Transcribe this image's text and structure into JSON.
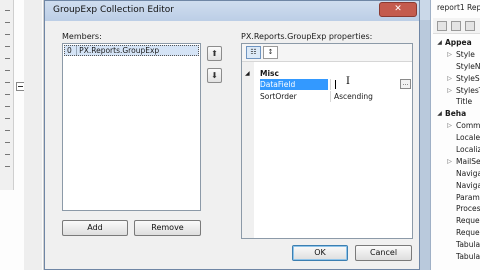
{
  "dialog": {
    "title": "GroupExp Collection Editor",
    "close_glyph": "✕",
    "members_label": "Members:",
    "members": [
      {
        "index": "0",
        "name": "PX.Reports.GroupExp"
      }
    ],
    "up_glyph": "⬆",
    "down_glyph": "⬇",
    "add_label": "Add",
    "remove_label": "Remove",
    "properties_label": "PX.Reports.GroupExp properties:",
    "categorized_glyph": "☷",
    "alphabetical_glyph": "↕",
    "category_toggle": "◢",
    "category": "Misc",
    "properties": [
      {
        "name": "DataField",
        "value": "",
        "selected": true
      },
      {
        "name": "SortOrder",
        "value": "Ascending",
        "selected": false
      }
    ],
    "ellipsis": "...",
    "ok_label": "OK",
    "cancel_label": "Cancel"
  },
  "ibeam": "I",
  "outer_window": {
    "minimize_glyph": "─",
    "restore_glyph": "▫"
  },
  "right_panel": {
    "title": "report1 Rep",
    "rows": [
      {
        "label": "Appea",
        "kind": "category",
        "glyph": "◢"
      },
      {
        "label": "Style",
        "kind": "item",
        "glyph": "▷"
      },
      {
        "label": "StyleNa",
        "kind": "item",
        "glyph": ""
      },
      {
        "label": "StyleSh",
        "kind": "item",
        "glyph": "▷"
      },
      {
        "label": "StylesT",
        "kind": "item",
        "glyph": "▷"
      },
      {
        "label": "Title",
        "kind": "item",
        "glyph": ""
      },
      {
        "label": "Beha",
        "kind": "category",
        "glyph": "◢"
      },
      {
        "label": "Commo",
        "kind": "item",
        "glyph": "▷"
      },
      {
        "label": "Locale",
        "kind": "item",
        "glyph": ""
      },
      {
        "label": "Localiz",
        "kind": "item",
        "glyph": ""
      },
      {
        "label": "MailSe",
        "kind": "item",
        "glyph": "▷"
      },
      {
        "label": "Naviga",
        "kind": "item",
        "glyph": ""
      },
      {
        "label": "Naviga",
        "kind": "item",
        "glyph": ""
      },
      {
        "label": "Param",
        "kind": "item",
        "glyph": ""
      },
      {
        "label": "Proces",
        "kind": "item",
        "glyph": ""
      },
      {
        "label": "Reque",
        "kind": "item",
        "glyph": ""
      },
      {
        "label": "Reque",
        "kind": "item",
        "glyph": ""
      },
      {
        "label": "Tabula",
        "kind": "item",
        "glyph": ""
      },
      {
        "label": "Tabula",
        "kind": "item",
        "glyph": ""
      }
    ]
  },
  "colors": {
    "selection": "#3399ff",
    "close_button": "#c45b4e",
    "title_bar": "#c4d5eb"
  }
}
